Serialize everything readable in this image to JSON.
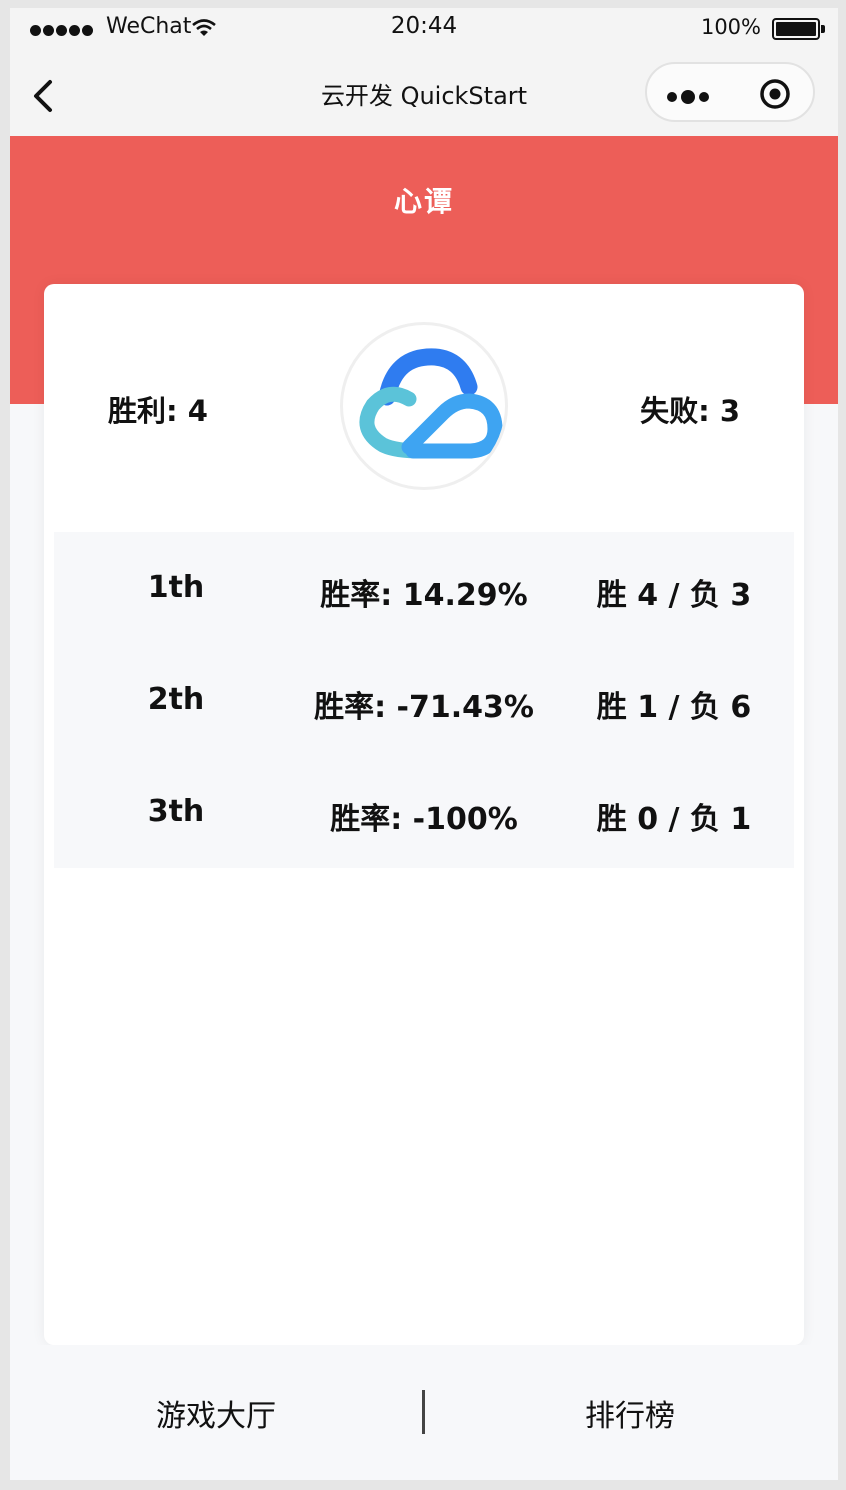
{
  "status_bar": {
    "carrier": "WeChat",
    "time": "20:44",
    "battery_percent": "100%"
  },
  "nav": {
    "title": "云开发 QuickStart",
    "back_icon": "chevron-left-icon",
    "more_icon": "more-dots-icon",
    "close_icon": "target-circle-icon"
  },
  "header": {
    "title": "心谭",
    "background_color": "#ed5e58"
  },
  "profile": {
    "wins_label": "胜利: 4",
    "losses_label": "失败: 3",
    "avatar_icon": "tencent-cloud-logo"
  },
  "rankings": [
    {
      "rank": "1th",
      "win_rate": "胜率: 14.29%",
      "record": "胜 4 / 负 3"
    },
    {
      "rank": "2th",
      "win_rate": "胜率: -71.43%",
      "record": "胜 1 / 负 6"
    },
    {
      "rank": "3th",
      "win_rate": "胜率: -100%",
      "record": "胜 0 / 负 1"
    }
  ],
  "tabbar": {
    "left_label": "游戏大厅",
    "right_label": "排行榜"
  }
}
